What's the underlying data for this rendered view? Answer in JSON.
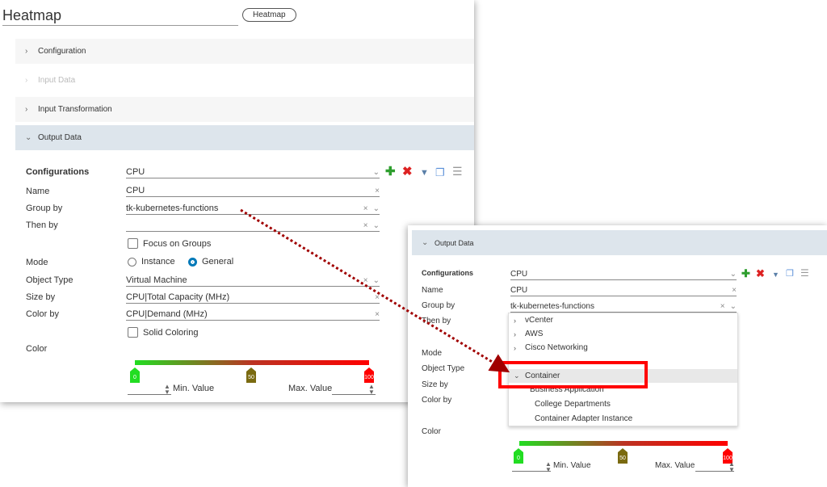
{
  "header": {
    "title": "Heatmap",
    "button_label": "Heatmap"
  },
  "sections": [
    {
      "label": "Configuration",
      "state": "collapsed"
    },
    {
      "label": "Input Data",
      "state": "disabled"
    },
    {
      "label": "Input Transformation",
      "state": "collapsed"
    },
    {
      "label": "Output Data",
      "state": "expanded"
    }
  ],
  "form": {
    "configurations_label": "Configurations",
    "configurations_value": "CPU",
    "name_label": "Name",
    "name_value": "CPU",
    "group_by_label": "Group by",
    "group_by_value": "tk-kubernetes-functions",
    "then_by_label": "Then by",
    "then_by_value": "",
    "focus_groups_label": "Focus on Groups",
    "mode_label": "Mode",
    "mode_instance": "Instance",
    "mode_general": "General",
    "mode_selected": "General",
    "object_type_label": "Object Type",
    "object_type_value": "Virtual Machine",
    "size_by_label": "Size by",
    "size_by_value": "CPU|Total Capacity (MHz)",
    "color_by_label": "Color by",
    "color_by_value": "CPU|Demand (MHz)",
    "solid_coloring_label": "Solid Coloring",
    "color_label": "Color",
    "min_marker": "0",
    "mid_marker": "50",
    "max_marker": "100",
    "min_value_label": "Min. Value",
    "max_value_label": "Max. Value"
  },
  "zoom": {
    "section_label": "Output Data",
    "configurations_label": "Configurations",
    "configurations_value": "CPU",
    "name_label": "Name",
    "name_value": "CPU",
    "group_by_label": "Group by",
    "group_by_value": "tk-kubernetes-functions",
    "then_by_label": "Then by",
    "mode_label": "Mode",
    "object_type_label": "Object Type",
    "size_by_label": "Size by",
    "color_by_label": "Color by",
    "color_label": "Color",
    "min_marker": "0",
    "mid_marker": "50",
    "max_marker": "100",
    "min_value_label": "Min. Value",
    "max_value_label": "Max. Value",
    "dropdown_items": [
      {
        "label": "vCenter",
        "type": "group-collapsed"
      },
      {
        "label": "AWS",
        "type": "group-collapsed"
      },
      {
        "label": "Cisco Networking",
        "type": "group-collapsed"
      },
      {
        "label": "Container",
        "type": "group-expanded"
      },
      {
        "label": "Business Application",
        "type": "child"
      },
      {
        "label": "College Departments",
        "type": "child"
      },
      {
        "label": "Container Adapter Instance",
        "type": "child"
      }
    ]
  },
  "colors": {
    "accent": "#0079b8",
    "add": "#2e9e2e",
    "delete": "#d22",
    "highlight": "#ff0000",
    "arrow": "#a00000",
    "min": "#22dd22",
    "mid": "#7a6a10",
    "max": "#ff0000"
  },
  "icons": [
    "add-icon",
    "delete-icon",
    "filter-icon",
    "copy-icon",
    "menu-icon"
  ]
}
